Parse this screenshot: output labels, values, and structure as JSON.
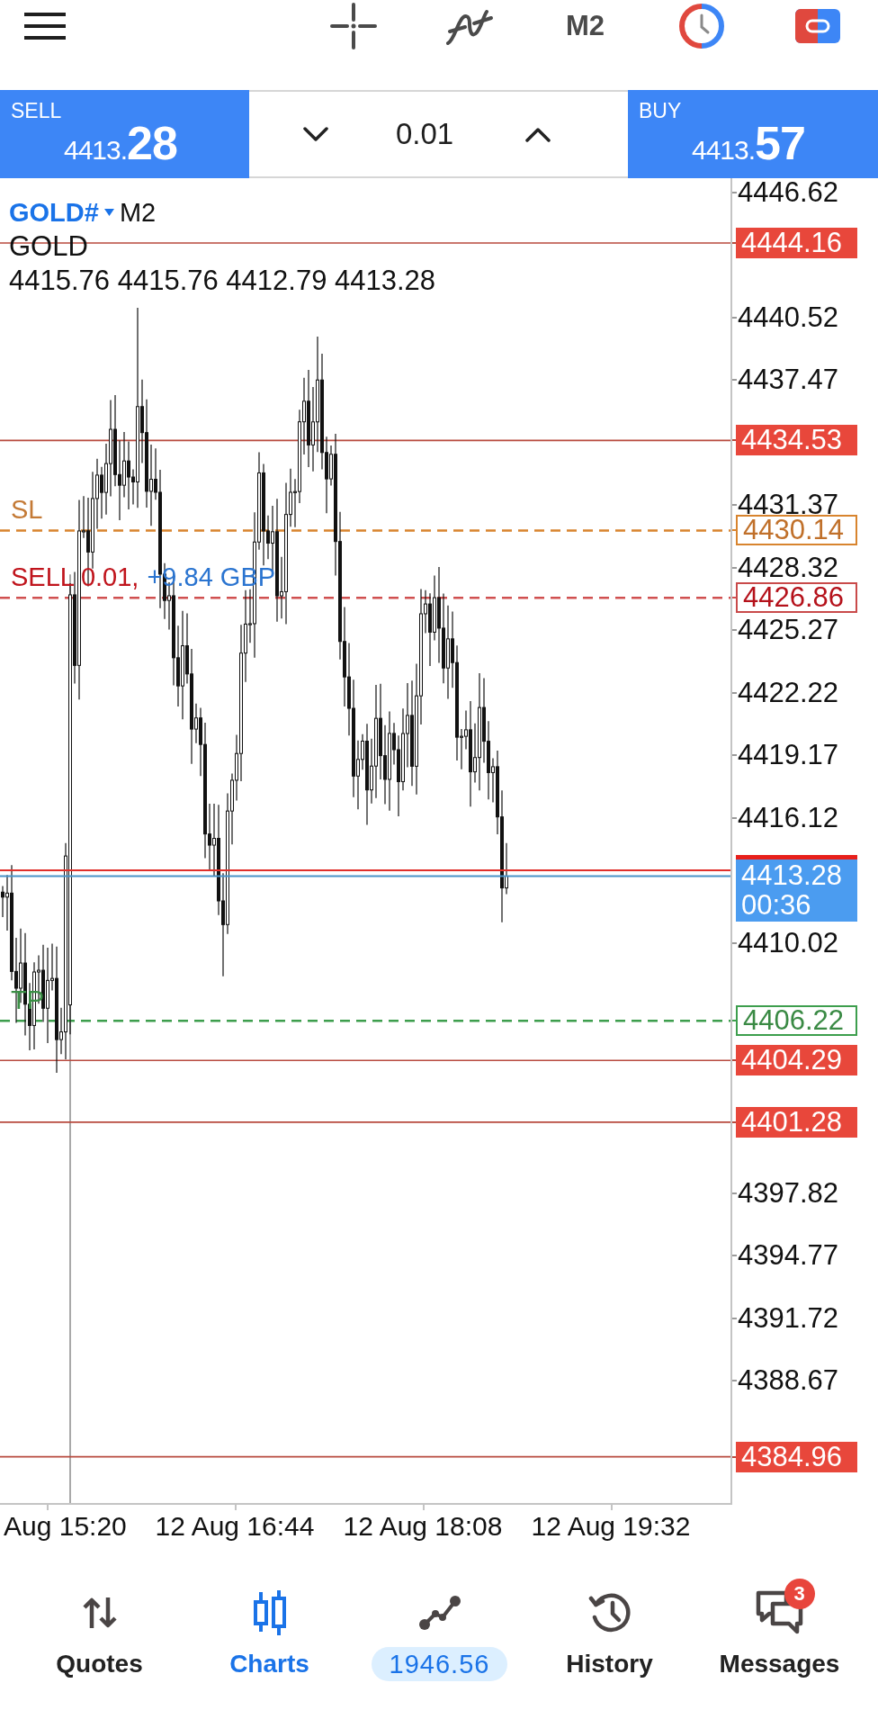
{
  "toolbar": {
    "timeframe": "M2"
  },
  "trade_panel": {
    "sell": {
      "label": "SELL",
      "price_head": "4413.",
      "price_tail": "28"
    },
    "volume": "0.01",
    "buy": {
      "label": "BUY",
      "price_head": "4413.",
      "price_tail": "57"
    }
  },
  "chart": {
    "symbol": "GOLD#",
    "timeframe": "M2",
    "description": "GOLD",
    "ohlc": "4415.76 4415.76 4412.79 4413.28",
    "levels": [
      {
        "kind": "line",
        "price": "4444.16"
      },
      {
        "kind": "line",
        "price": "4434.53"
      },
      {
        "kind": "stop_loss",
        "price": "4430.14",
        "label": "SL"
      },
      {
        "kind": "order",
        "price": "4426.86",
        "label": "SELL 0.01,",
        "profit": "+9.84 GBP"
      },
      {
        "kind": "take_profit",
        "price": "4406.22",
        "label": "TP"
      },
      {
        "kind": "line",
        "price": "4404.29"
      },
      {
        "kind": "line",
        "price": "4401.28"
      },
      {
        "kind": "line",
        "price": "4384.96"
      }
    ],
    "bid": {
      "price": "4413.28",
      "countdown": "00:36"
    },
    "price_axis": [
      "4446.62",
      "4440.52",
      "4437.47",
      "4431.37",
      "4428.32",
      "4425.27",
      "4422.22",
      "4419.17",
      "4416.12",
      "4410.02",
      "4397.82",
      "4394.77",
      "4391.72",
      "4388.67"
    ],
    "time_axis": [
      "Aug 15:20",
      "12 Aug 16:44",
      "12 Aug 18:08",
      "12 Aug 19:32"
    ]
  },
  "nav": [
    {
      "kind": "tab",
      "label": "Quotes",
      "selected": false
    },
    {
      "kind": "tab",
      "label": "Charts",
      "selected": true
    },
    {
      "kind": "balance",
      "label": "1946.56",
      "selected": false
    },
    {
      "kind": "tab",
      "label": "History",
      "selected": false
    },
    {
      "kind": "tab",
      "label": "Messages",
      "selected": false,
      "badge": "3"
    }
  ]
}
